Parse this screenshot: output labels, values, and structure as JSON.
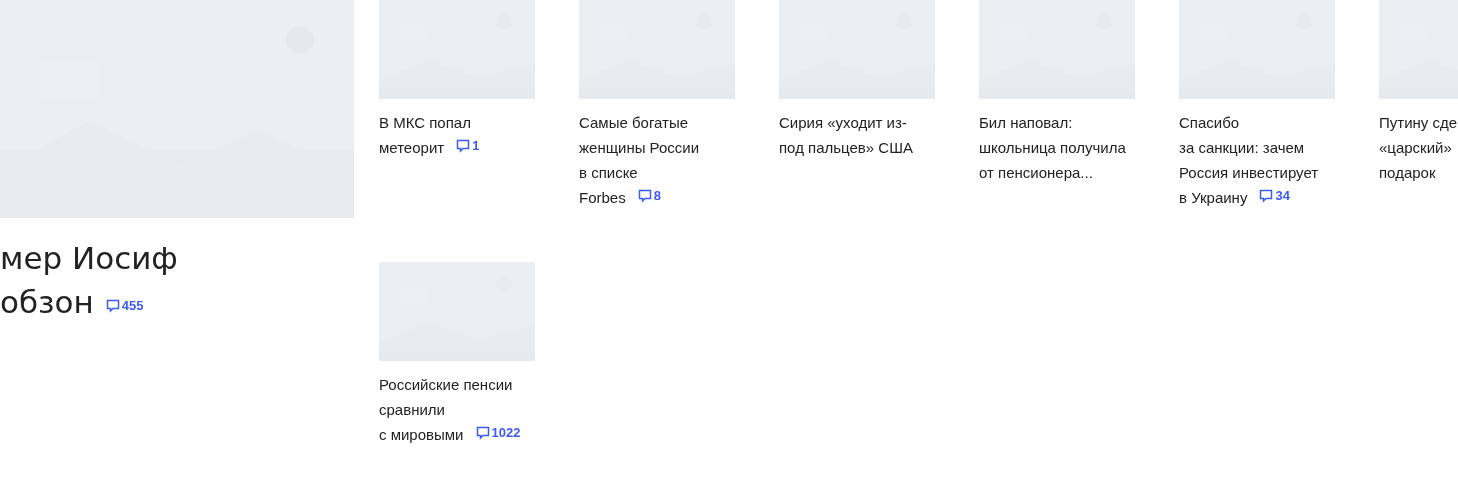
{
  "lead": {
    "title_lines": [
      "мер Иосиф",
      "обзон"
    ],
    "comments": "455"
  },
  "cards": [
    {
      "title_lines": [
        "В МКС попал",
        "метеорит"
      ],
      "comments": "1"
    },
    {
      "title_lines": [
        "Самые богатые",
        "женщины России",
        "в списке",
        "Forbes"
      ],
      "comments": "8"
    },
    {
      "title_lines": [
        "Сирия «уходит из-",
        "под пальцев» США"
      ]
    },
    {
      "title_lines": [
        "Бил наповал:",
        "школьница получила",
        "от пенсионера..."
      ]
    },
    {
      "title_lines": [
        "Спасибо",
        "за санкции: зачем",
        "Россия инвестирует",
        "в Украину"
      ],
      "comments": "34"
    },
    {
      "title_lines": [
        "Путину сде",
        "«царский»",
        "подарок"
      ]
    },
    {
      "title_lines": [
        "Российские пенсии",
        "сравнили",
        "с мировыми"
      ],
      "comments": "1022"
    }
  ]
}
